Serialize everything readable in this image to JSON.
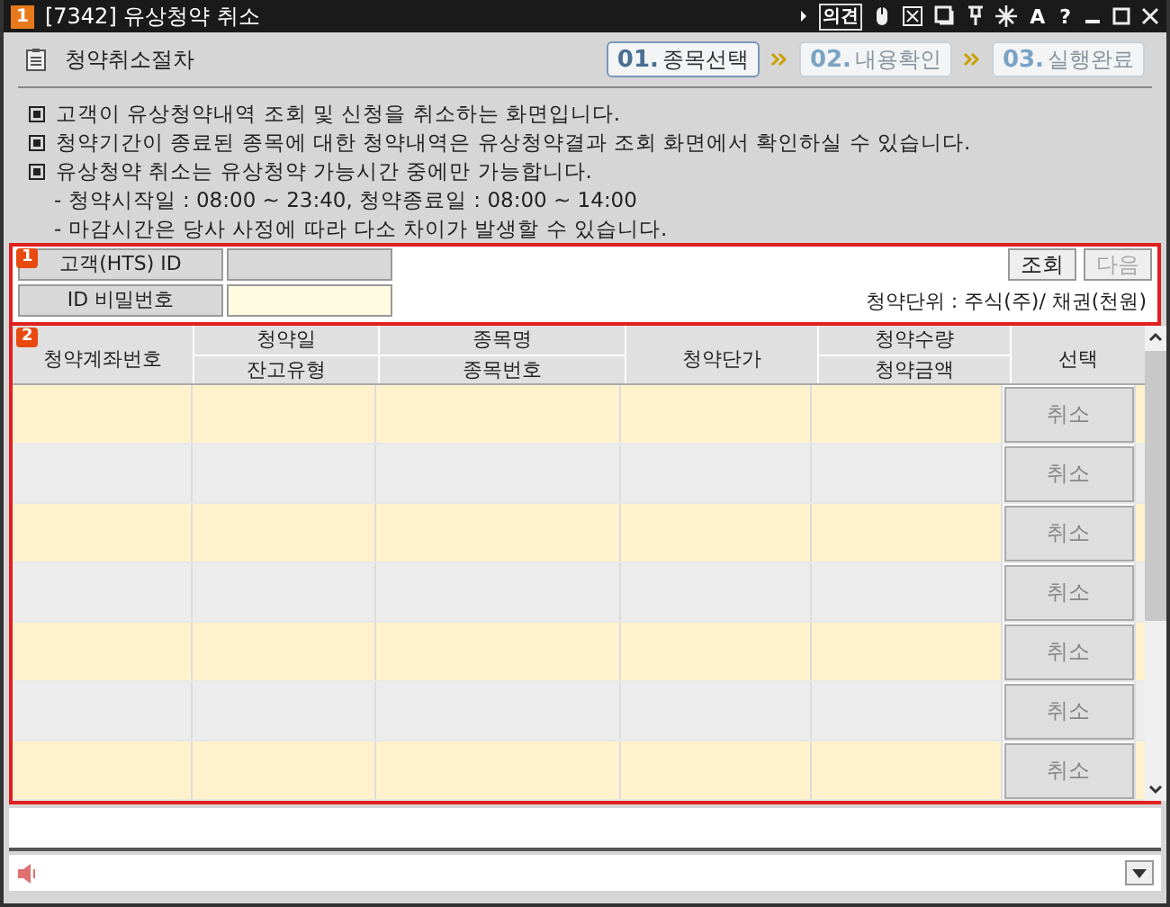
{
  "window": {
    "badge": "1",
    "title": "[7342] 유상청약 취소",
    "tools": [
      "의견",
      "A",
      "?"
    ]
  },
  "header": {
    "title": "청약취소절차",
    "steps": [
      {
        "number": "01.",
        "label": "종목선택",
        "selected": true
      },
      {
        "number": "02.",
        "label": "내용확인",
        "selected": false
      },
      {
        "number": "03.",
        "label": "실행완료",
        "selected": false
      }
    ]
  },
  "notes": [
    {
      "kind": "bullet",
      "text": "고객이 유상청약내역 조회 및 신청을 취소하는 화면입니다."
    },
    {
      "kind": "bullet",
      "text": "청약기간이 종료된 종목에 대한 청약내역은 유상청약결과 조회 화면에서 확인하실 수 있습니다."
    },
    {
      "kind": "bullet",
      "text": "유상청약 취소는 유상청약 가능시간 중에만 가능합니다."
    },
    {
      "kind": "dash",
      "text": "- 청약시작일 : 08:00 ~ 23:40,  청약종료일 : 08:00 ~ 14:00"
    },
    {
      "kind": "dash",
      "text": "- 마감시간은 당사 사정에 따라 다소 차이가 발생할 수 있습니다."
    }
  ],
  "form": {
    "badge": "1",
    "id_label": "고객(HTS) ID",
    "password_label": "ID 비밀번호",
    "buttons": [
      {
        "label": "조회",
        "disabled": false
      },
      {
        "label": "다음",
        "disabled": true
      }
    ],
    "unit_note": "청약단위 : 주식(주)/ 채권(천원)"
  },
  "table": {
    "badge": "2",
    "columns": [
      {
        "top": "청약계좌번호"
      },
      {
        "top": "청약일",
        "bottom": "잔고유형"
      },
      {
        "top": "종목명",
        "bottom": "종목번호"
      },
      {
        "top": "청약단가"
      },
      {
        "top": "청약수량",
        "bottom": "청약금액"
      },
      {
        "top": "선택"
      }
    ],
    "rows": [
      {
        "action": "취소"
      },
      {
        "action": "취소"
      },
      {
        "action": "취소"
      },
      {
        "action": "취소"
      },
      {
        "action": "취소"
      },
      {
        "action": "취소"
      },
      {
        "action": "취소"
      }
    ]
  }
}
